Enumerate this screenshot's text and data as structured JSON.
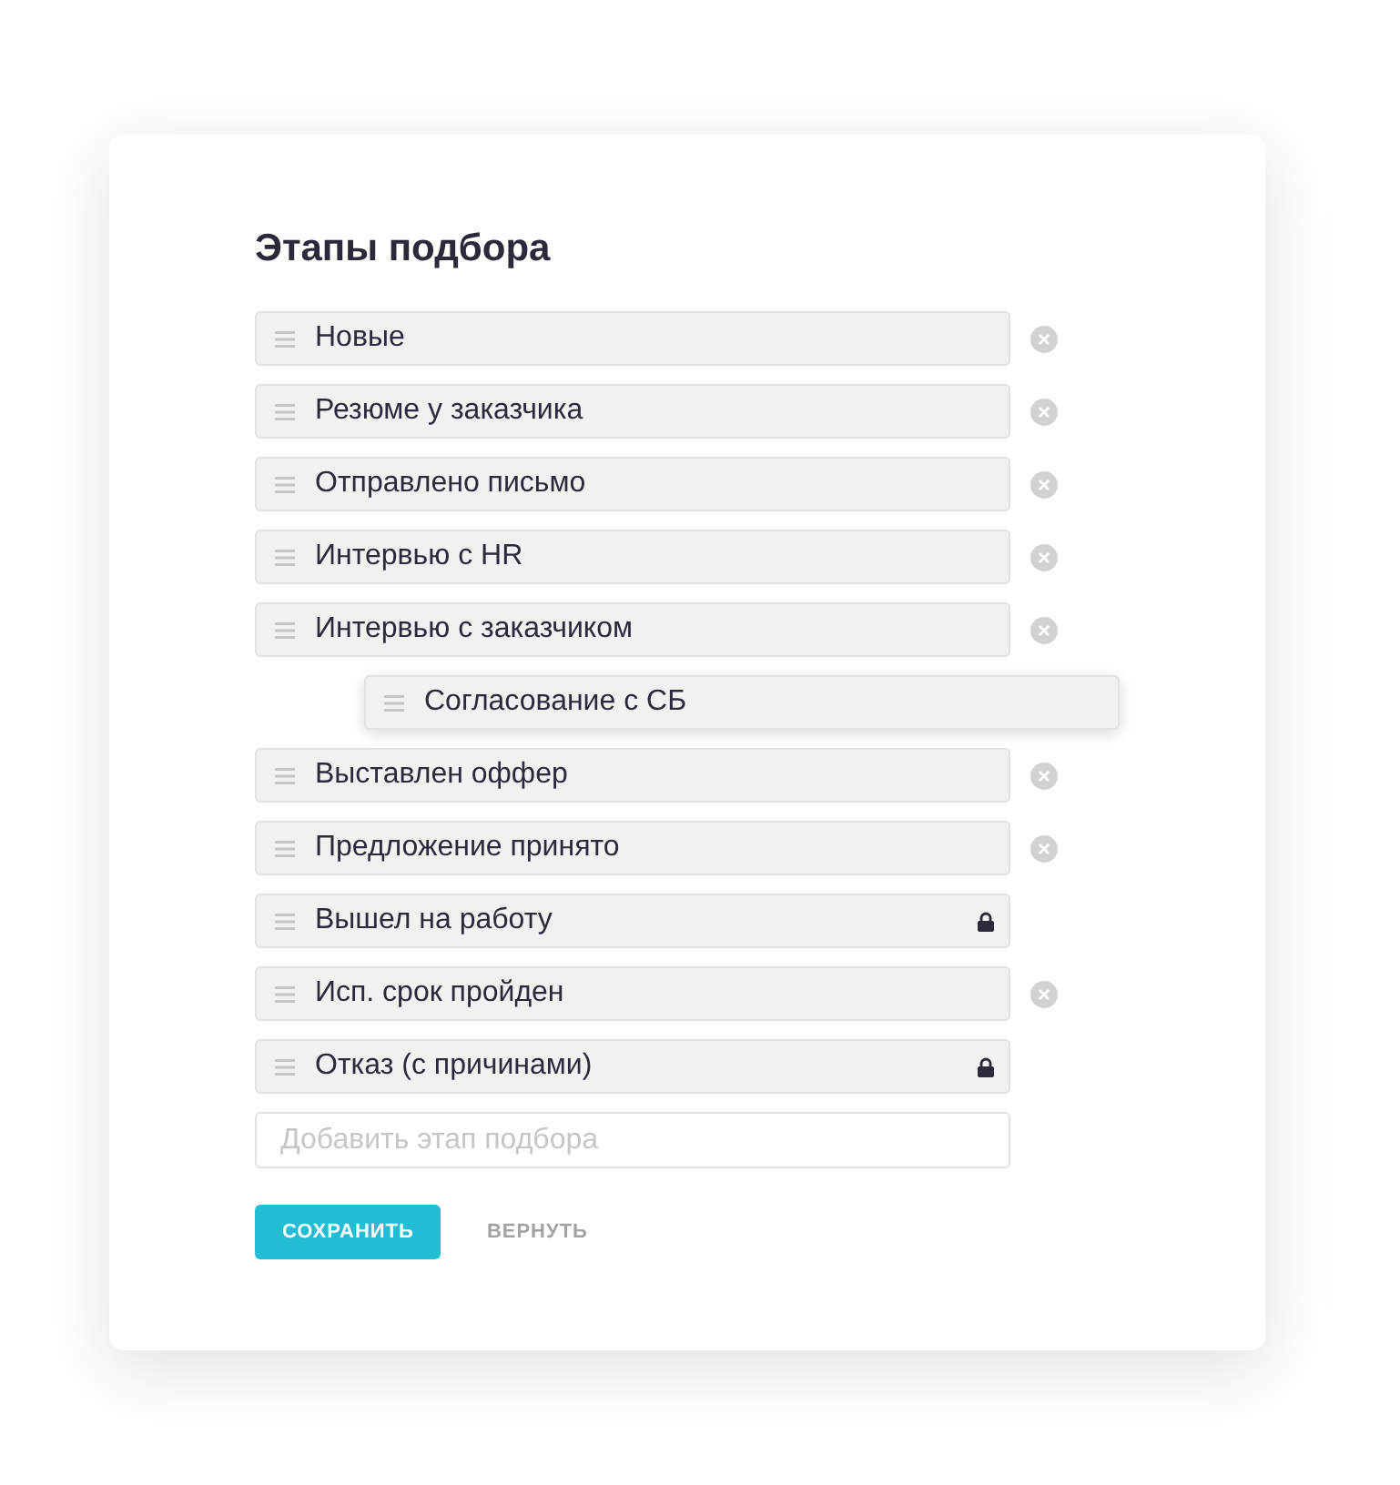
{
  "title": "Этапы подбора",
  "stages": [
    {
      "label": "Новые",
      "kind": "removable"
    },
    {
      "label": "Резюме у заказчика",
      "kind": "removable"
    },
    {
      "label": "Отправлено письмо",
      "kind": "removable"
    },
    {
      "label": "Интервью с HR",
      "kind": "removable"
    },
    {
      "label": "Интервью с заказчиком",
      "kind": "removable"
    },
    {
      "label": "Согласование с СБ",
      "kind": "dragging"
    },
    {
      "label": "Выставлен оффер",
      "kind": "removable"
    },
    {
      "label": "Предложение принято",
      "kind": "removable"
    },
    {
      "label": "Вышел на работу",
      "kind": "locked"
    },
    {
      "label": "Исп. срок пройден",
      "kind": "removable"
    },
    {
      "label": "Отказ (с причинами)",
      "kind": "locked"
    }
  ],
  "add_field": {
    "placeholder": "Добавить этап подбора"
  },
  "buttons": [
    {
      "label": "СОХРАНИТЬ",
      "kind": "primary"
    },
    {
      "label": "ВЕРНУТЬ",
      "kind": "link"
    }
  ]
}
